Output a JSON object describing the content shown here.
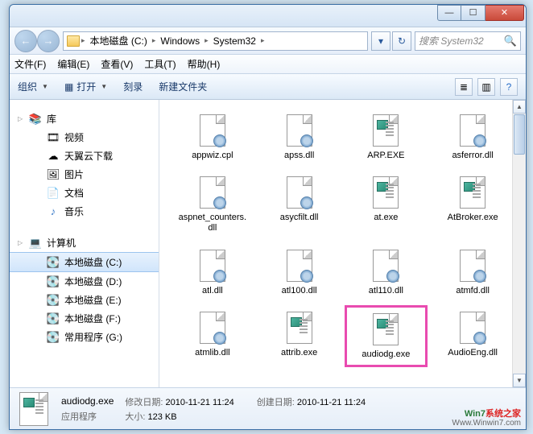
{
  "window": {
    "min": "—",
    "max": "☐",
    "close": "✕"
  },
  "nav": {
    "back": "←",
    "fwd": "→",
    "crumbs": [
      "本地磁盘 (C:)",
      "Windows",
      "System32"
    ],
    "down": "▾",
    "refresh": "↻",
    "search_placeholder": "搜索 System32"
  },
  "menu": {
    "file": "文件(F)",
    "edit": "编辑(E)",
    "view": "查看(V)",
    "tools": "工具(T)",
    "help": "帮助(H)"
  },
  "toolbar": {
    "organize": "组织",
    "open": "打开",
    "burn": "刻录",
    "new_folder": "新建文件夹",
    "view_ico": "≣",
    "pane_ico": "▥",
    "help_ico": "?"
  },
  "sidebar": {
    "lib_head": "库",
    "lib_items": [
      "视频",
      "天翼云下载",
      "图片",
      "文档",
      "音乐"
    ],
    "pc_head": "计算机",
    "pc_items": [
      "本地磁盘 (C:)",
      "本地磁盘 (D:)",
      "本地磁盘 (E:)",
      "本地磁盘 (F:)",
      "常用程序 (G:)"
    ]
  },
  "files": [
    {
      "name": "appwiz.cpl",
      "type": "dll"
    },
    {
      "name": "apss.dll",
      "type": "dll"
    },
    {
      "name": "ARP.EXE",
      "type": "exe"
    },
    {
      "name": "asferror.dll",
      "type": "dll"
    },
    {
      "name": "aspnet_counters.dll",
      "type": "dll"
    },
    {
      "name": "asycfilt.dll",
      "type": "dll"
    },
    {
      "name": "at.exe",
      "type": "exe"
    },
    {
      "name": "AtBroker.exe",
      "type": "exe"
    },
    {
      "name": "atl.dll",
      "type": "dll"
    },
    {
      "name": "atl100.dll",
      "type": "dll"
    },
    {
      "name": "atl110.dll",
      "type": "dll"
    },
    {
      "name": "atmfd.dll",
      "type": "dll"
    },
    {
      "name": "atmlib.dll",
      "type": "dll"
    },
    {
      "name": "attrib.exe",
      "type": "exe"
    },
    {
      "name": "audiodg.exe",
      "type": "exe",
      "hl": true
    },
    {
      "name": "AudioEng.dll",
      "type": "dll"
    }
  ],
  "status": {
    "filename": "audiodg.exe",
    "filetype": "应用程序",
    "mod_label": "修改日期:",
    "mod_value": "2010-11-21 11:24",
    "cre_label": "创建日期:",
    "cre_value": "2010-11-21 11:24",
    "size_label": "大小:",
    "size_value": "123 KB"
  },
  "watermark": {
    "line1a": "Win7",
    "line1b": "系统之家",
    "line2": "Www.Winwin7.com"
  }
}
